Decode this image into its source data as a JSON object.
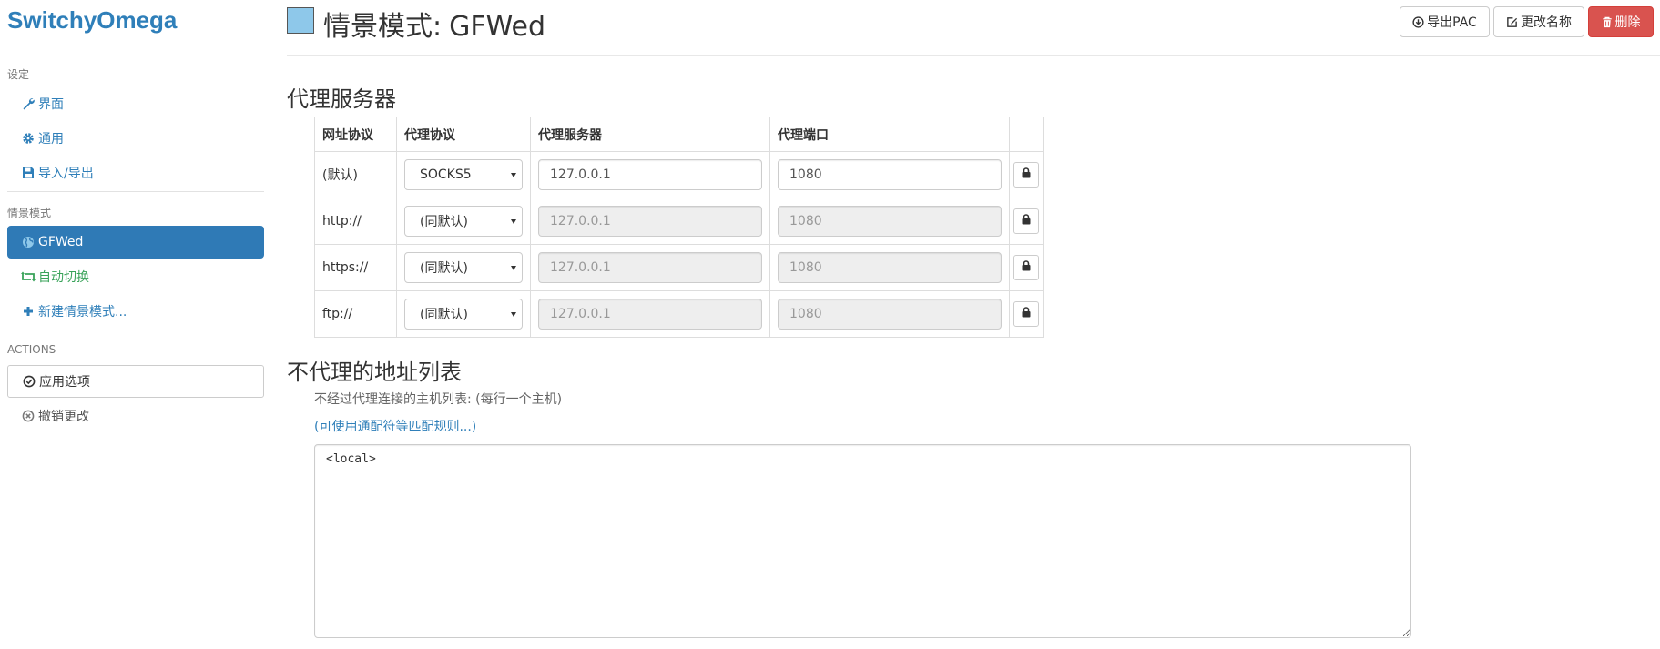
{
  "sidebar": {
    "brand": "SwitchyOmega",
    "settings_heading": "设定",
    "settings_items": [
      {
        "label": "界面",
        "icon": "wrench-icon"
      },
      {
        "label": "通用",
        "icon": "gear-icon"
      },
      {
        "label": "导入/导出",
        "icon": "floppy-disk-icon"
      }
    ],
    "profiles_heading": "情景模式",
    "profiles": [
      {
        "label": "GFWed",
        "icon": "globe-icon",
        "active": true
      },
      {
        "label": "自动切换",
        "icon": "retweet-icon",
        "active": false
      },
      {
        "label": "新建情景模式...",
        "icon": "plus-icon",
        "active": false
      }
    ],
    "actions_heading": "ACTIONS",
    "actions": [
      {
        "label": "应用选项",
        "icon": "check-circle-icon"
      },
      {
        "label": "撤销更改",
        "icon": "x-circle-icon"
      }
    ]
  },
  "header": {
    "title_prefix": "情景模式:",
    "profile_name": "GFWed",
    "profile_color": "#8ec8ea",
    "buttons": {
      "export_pac": "导出PAC",
      "rename": "更改名称",
      "delete": "删除"
    }
  },
  "proxy_servers": {
    "section_title": "代理服务器",
    "columns": [
      "网址协议",
      "代理协议",
      "代理服务器",
      "代理端口"
    ],
    "rows": [
      {
        "scheme": "(默认)",
        "protocol": "SOCKS5",
        "server": "127.0.0.1",
        "port": "1080",
        "disabled": false
      },
      {
        "scheme": "http://",
        "protocol": "(同默认)",
        "server": "127.0.0.1",
        "port": "1080",
        "disabled": true
      },
      {
        "scheme": "https://",
        "protocol": "(同默认)",
        "server": "127.0.0.1",
        "port": "1080",
        "disabled": true
      },
      {
        "scheme": "ftp://",
        "protocol": "(同默认)",
        "server": "127.0.0.1",
        "port": "1080",
        "disabled": true
      }
    ]
  },
  "bypass": {
    "section_title": "不代理的地址列表",
    "help": "不经过代理连接的主机列表: (每行一个主机)",
    "wildcard_link": "(可使用通配符等匹配规则...)",
    "list_text": "<local>"
  },
  "colors": {
    "brand": "#2f7fb9",
    "active_bg": "#2f7ab6",
    "auto_switch": "#3aa35a",
    "danger": "#d9534f"
  }
}
